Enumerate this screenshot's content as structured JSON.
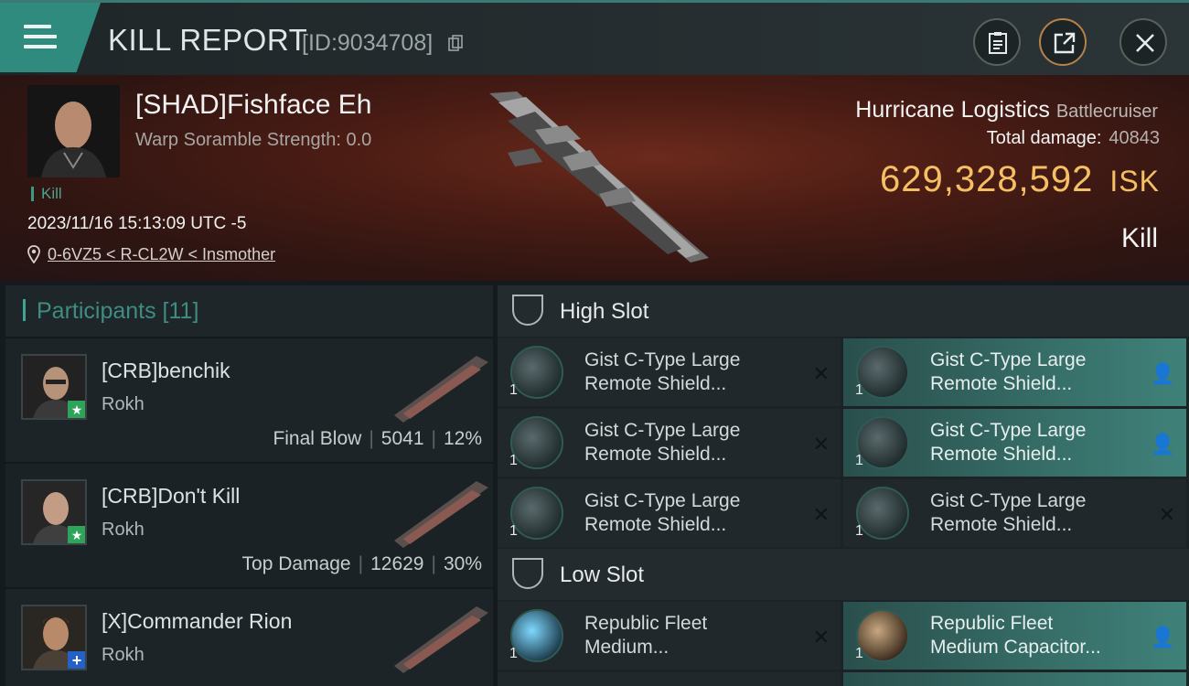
{
  "header": {
    "title": "KILL REPORT",
    "report_id": "[ID:9034708]",
    "icons": [
      "menu-icon",
      "copy-icon",
      "clipboard-icon",
      "share-icon",
      "close-icon"
    ]
  },
  "victim": {
    "name": "[SHAD]Fishface Eh",
    "scramble": "Warp Soramble Strength: 0.0",
    "tag": "Kill",
    "datetime": "2023/11/16 15:13:09 UTC -5",
    "location": "0-6VZ5 < R-CL2W < Insmother",
    "ship_name": "Hurricane Logistics",
    "ship_class": "Battlecruiser",
    "total_damage_label": "Total damage:",
    "total_damage": "40843",
    "isk_value": "629,328,592",
    "isk_unit": "ISK",
    "kill_type": "Kill"
  },
  "participants": {
    "label": "Participants [11]",
    "rows": [
      {
        "name": "[CRB]benchik",
        "ship": "Rokh",
        "role": "Final Blow",
        "damage": "5041",
        "percent": "12%",
        "badge": "★"
      },
      {
        "name": "[CRB]Don't Kill",
        "ship": "Rokh",
        "role": "Top Damage",
        "damage": "12629",
        "percent": "30%",
        "badge": "★"
      },
      {
        "name": "[X]Commander Rion",
        "ship": "Rokh",
        "role": "",
        "damage": "",
        "percent": "",
        "badge": "+"
      }
    ]
  },
  "slots": {
    "high_label": "High Slot",
    "low_label": "Low Slot",
    "high_items": [
      {
        "name1": "Gist C-Type Large",
        "name2": "Remote Shield...",
        "qty": "1",
        "action": "✕"
      },
      {
        "name1": "Gist C-Type Large",
        "name2": "Remote Shield...",
        "qty": "1",
        "action": "👤"
      },
      {
        "name1": "Gist C-Type Large",
        "name2": "Remote Shield...",
        "qty": "1",
        "action": "✕"
      },
      {
        "name1": "Gist C-Type Large",
        "name2": "Remote Shield...",
        "qty": "1",
        "action": "👤"
      },
      {
        "name1": "Gist C-Type Large",
        "name2": "Remote Shield...",
        "qty": "1",
        "action": "✕"
      },
      {
        "name1": "Gist C-Type Large",
        "name2": "Remote Shield...",
        "qty": "1",
        "action": "✕"
      }
    ],
    "low_items": [
      {
        "name1": "Republic Fleet",
        "name2": "Medium...",
        "qty": "1",
        "action": "✕"
      },
      {
        "name1": "Republic Fleet",
        "name2": "Medium Capacitor...",
        "qty": "1",
        "action": "👤"
      }
    ]
  },
  "colors": {
    "accent": "#2f8b7e",
    "isk": "#f4c063",
    "teal_row": "#3f827a"
  }
}
